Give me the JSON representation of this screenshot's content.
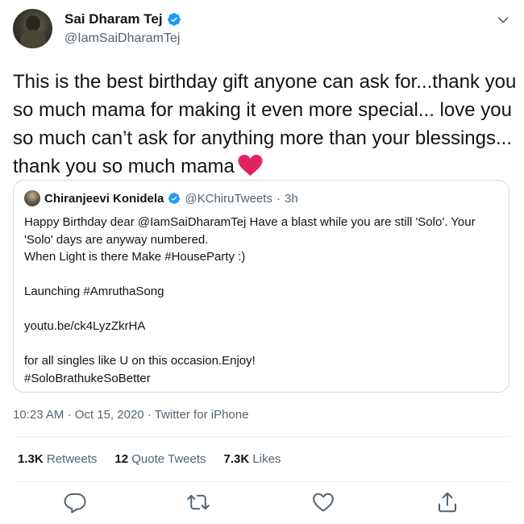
{
  "author": {
    "name": "Sai Dharam Tej",
    "handle": "@IamSaiDharamTej"
  },
  "tweet": {
    "text": "This is the best birthday gift anyone can ask for...thank you so much mama for making it even more special... love you so much can’t ask for anything more than your blessings... thank you so much mama"
  },
  "quote": {
    "name": "Chiranjeevi Konidela",
    "handle": "@KChiruTweets",
    "separator": "·",
    "time": "3h",
    "lines": [
      "Happy Birthday dear @IamSaiDharamTej Have a blast while you are still 'Solo'. Your",
      "'Solo' days are anyway numbered.",
      "When Light is there Make #HouseParty  :)",
      "Launching #AmruthaSong",
      "youtu.be/ck4LyzZkrHA",
      "for all singles like U on this occasion.Enjoy!",
      "#SoloBrathukeSoBetter"
    ]
  },
  "meta": {
    "time": "10:23 AM",
    "sep1": "·",
    "date": "Oct 15, 2020",
    "sep2": "·",
    "source": "Twitter for iPhone"
  },
  "stats": {
    "retweets_count": "1.3K",
    "retweets_label": "Retweets",
    "quotes_count": "12",
    "quotes_label": "Quote Tweets",
    "likes_count": "7.3K",
    "likes_label": "Likes"
  },
  "colors": {
    "text": "#0f1419",
    "secondary": "#536471",
    "verified": "#1d9bf0",
    "heart": "#e0245e",
    "border": "#cfd9de"
  },
  "icons": {
    "verified": "verified-badge-icon",
    "more": "chevron-down-icon",
    "heart": "red-heart-emoji-icon",
    "reply": "reply-icon",
    "retweet": "retweet-icon",
    "like": "like-icon",
    "share": "share-icon"
  }
}
